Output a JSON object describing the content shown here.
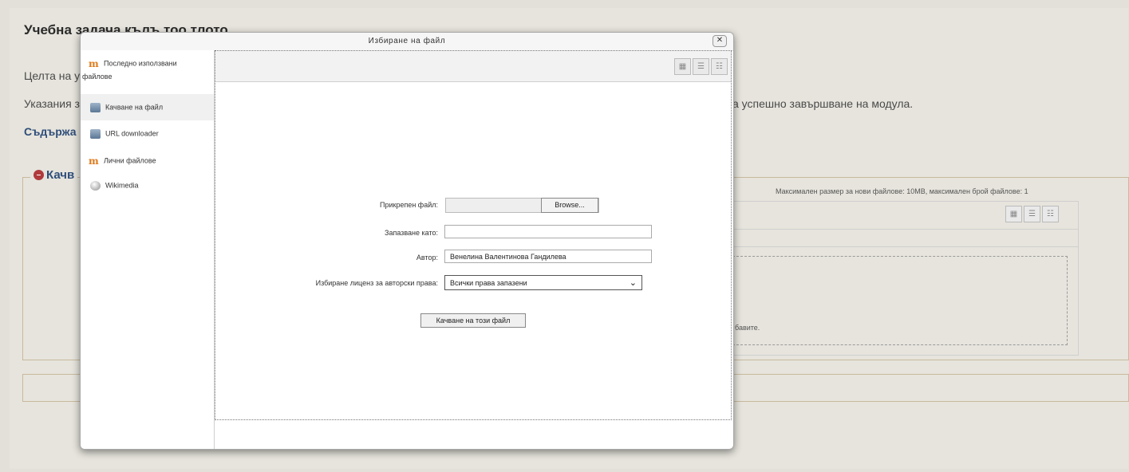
{
  "background": {
    "title": "Учебна задача кълъ тоо тлото",
    "intro_text": "Целта на у",
    "instructions_text": "Указания з",
    "instructions_tail": "а успешно завършване на модула.",
    "contents_link": "Съдържа",
    "section_legend": "Качв",
    "max_info": "Максимален размер за нови файлове: 10MB, максимален брой файлове: 1",
    "drop_hint": "бавите."
  },
  "dialog": {
    "title": "Избиране на файл",
    "close_glyph": "✕",
    "sidebar": [
      {
        "label_line1": "Последно използвани",
        "label_line2": "файлове",
        "icon": "moodle-icon"
      },
      {
        "label_line1": "Качване на файл",
        "icon": "upload-icon"
      },
      {
        "label_line1": "URL downloader",
        "icon": "upload-icon"
      },
      {
        "label_line1": "Лични файлове",
        "icon": "moodle-icon"
      },
      {
        "label_line1": "Wikimedia",
        "icon": "wikimedia-icon"
      }
    ],
    "view_icons": [
      "grid-view-icon",
      "list-view-icon",
      "tree-view-icon"
    ],
    "form": {
      "attached_label": "Прикрепен файл:",
      "browse_label": "Browse...",
      "save_as_label": "Запазване като:",
      "save_as_value": "",
      "author_label": "Автор:",
      "author_value": "Венелина Валентинова Гандилева",
      "license_label": "Избиране лиценз за авторски права:",
      "license_value": "Всички права запазени",
      "upload_button": "Качване на този файл"
    }
  },
  "colors": {
    "accent_link": "#2f4d7a",
    "moodle_orange": "#e07a1b",
    "legend_icon": "#b0393b"
  }
}
